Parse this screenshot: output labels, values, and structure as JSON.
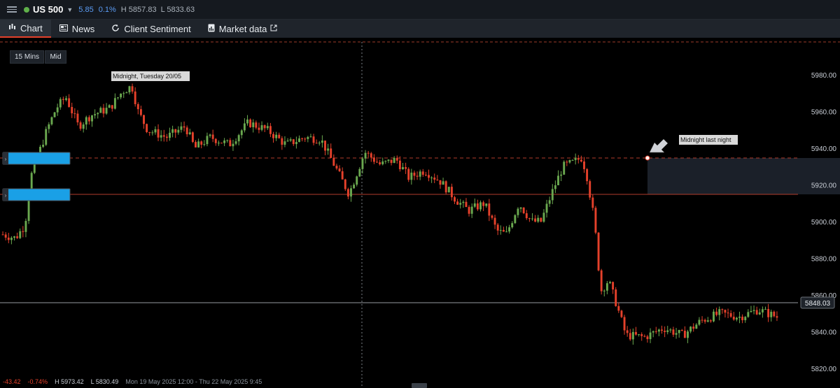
{
  "header": {
    "instrument": "US 500",
    "change": "5.85",
    "change_pct": "0.1%",
    "high": "H 5857.83",
    "low": "L 5833.63",
    "status_color": "#5fb04a"
  },
  "tabs": [
    {
      "label": "Chart",
      "icon": "candlestick-icon",
      "active": true
    },
    {
      "label": "News",
      "icon": "newspaper-icon"
    },
    {
      "label": "Client Sentiment",
      "icon": "refresh-icon"
    },
    {
      "label": "Market data",
      "icon": "document-icon",
      "external": true
    }
  ],
  "controls": {
    "timeframe": "15 Mins",
    "price_type": "Mid"
  },
  "annotations": {
    "midnight_tuesday": "Midnight, Tuesday 20/05",
    "midnight_last_night": "Midnight last night"
  },
  "price_axis": [
    "5980.00",
    "5960.00",
    "5940.00",
    "5920.00",
    "5900.00",
    "5880.00",
    "5860.00",
    "5840.00",
    "5820.00"
  ],
  "current_price": "5848.03",
  "footer": {
    "change": "-43.42",
    "change_pct": "-0.74%",
    "high": "H 5973.42",
    "low": "L 5830.49",
    "range": "Mon 19 May 2025 12:00 - Thu 22 May 2025 9:45"
  },
  "colors": {
    "up": "#6aa84f",
    "down": "#e5412b",
    "accent": "#e5412b",
    "order_box": "#1aa0e6"
  },
  "chart_data": {
    "type": "candlestick",
    "y_label_side": "right",
    "ylim": [
      5810,
      5998
    ],
    "price_lines": [
      5931,
      5910
    ],
    "close_path": [
      [
        0,
        5893
      ],
      [
        0.02,
        5891
      ],
      [
        0.035,
        5898
      ],
      [
        0.045,
        5925
      ],
      [
        0.055,
        5935
      ],
      [
        0.07,
        5950
      ],
      [
        0.085,
        5962
      ],
      [
        0.1,
        5968
      ],
      [
        0.12,
        5952
      ],
      [
        0.14,
        5958
      ],
      [
        0.17,
        5962
      ],
      [
        0.19,
        5971
      ],
      [
        0.205,
        5974
      ],
      [
        0.215,
        5960
      ],
      [
        0.23,
        5950
      ],
      [
        0.26,
        5946
      ],
      [
        0.29,
        5952
      ],
      [
        0.305,
        5940
      ],
      [
        0.33,
        5946
      ],
      [
        0.36,
        5942
      ],
      [
        0.39,
        5954
      ],
      [
        0.42,
        5950
      ],
      [
        0.45,
        5942
      ],
      [
        0.48,
        5946
      ],
      [
        0.505,
        5945
      ],
      [
        0.525,
        5932
      ],
      [
        0.55,
        5915
      ],
      [
        0.575,
        5938
      ],
      [
        0.6,
        5931
      ],
      [
        0.625,
        5934
      ],
      [
        0.645,
        5924
      ],
      [
        0.67,
        5928
      ],
      [
        0.695,
        5922
      ],
      [
        0.72,
        5912
      ],
      [
        0.74,
        5906
      ],
      [
        0.765,
        5910
      ],
      [
        0.785,
        5895
      ],
      [
        0.8,
        5893
      ],
      [
        0.82,
        5910
      ],
      [
        0.84,
        5900
      ],
      [
        0.855,
        5900
      ],
      [
        0.875,
        5918
      ],
      [
        0.89,
        5930
      ],
      [
        0.905,
        5932
      ],
      [
        0.92,
        5935
      ],
      [
        0.928,
        5925
      ],
      [
        0.94,
        5900
      ],
      [
        0.95,
        5862
      ],
      [
        0.962,
        5868
      ],
      [
        0.975,
        5855
      ],
      [
        0.99,
        5838
      ],
      [
        1.02,
        5837
      ],
      [
        1.05,
        5842
      ],
      [
        1.08,
        5838
      ],
      [
        1.11,
        5846
      ],
      [
        1.14,
        5850
      ],
      [
        1.17,
        5848
      ],
      [
        1.2,
        5852
      ],
      [
        1.23,
        5848
      ]
    ]
  }
}
